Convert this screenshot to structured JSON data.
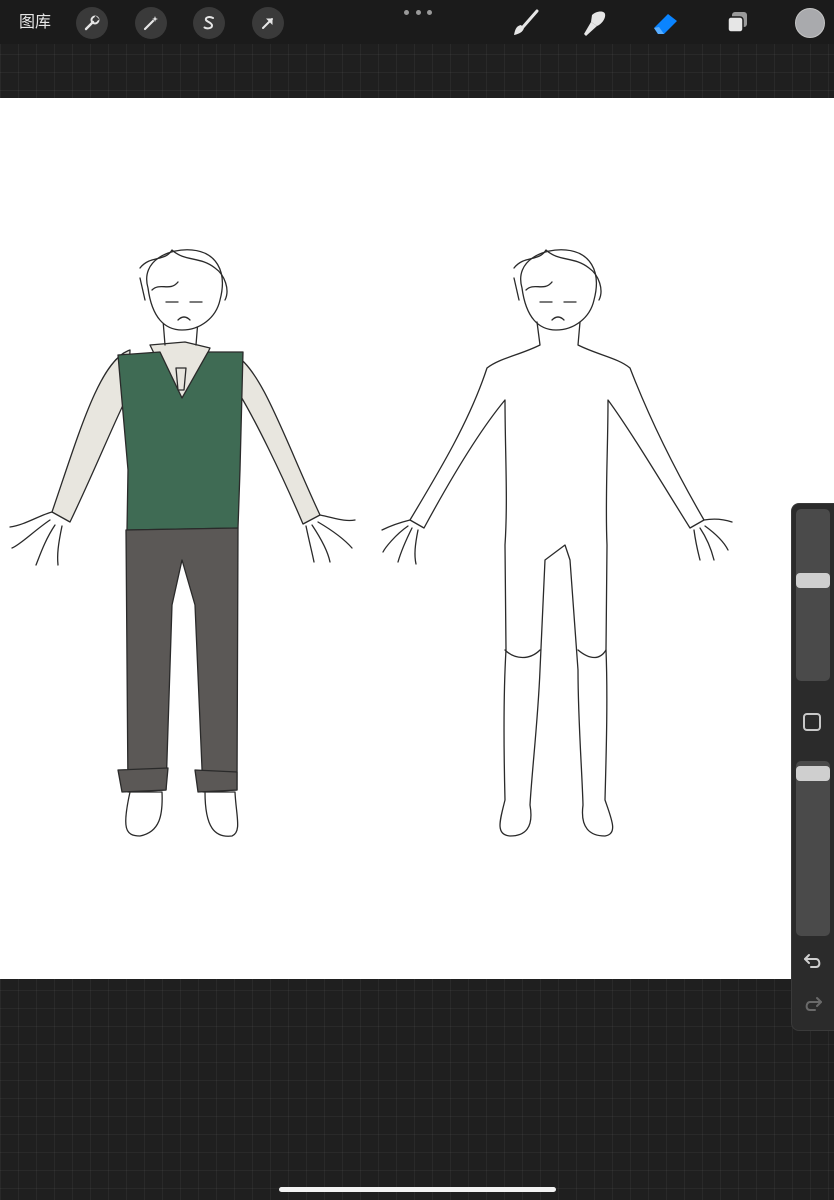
{
  "toolbar": {
    "gallery_label": "图库",
    "left_tools": [
      "wrench-icon",
      "magic-wand-icon",
      "selection-s-icon",
      "transform-arrow-icon"
    ],
    "right_tools": [
      "brush-icon",
      "smudge-icon",
      "eraser-icon",
      "layers-icon"
    ],
    "active_tool": "eraser",
    "active_color": "#0a84ff",
    "current_color": "#a9aaad"
  },
  "canvas": {
    "background": "#ffffff",
    "artwork": "character-turnaround-sketch",
    "colors": {
      "vest": "#3f6b54",
      "shirt": "#e8e6df",
      "pants": "#5b5856",
      "line": "#2a2a2a"
    }
  },
  "sidebar": {
    "brush_size": 0.53,
    "opacity": 0.9,
    "controls": [
      "brush-size-slider",
      "modify-button",
      "opacity-slider",
      "undo-icon",
      "redo-icon"
    ]
  }
}
